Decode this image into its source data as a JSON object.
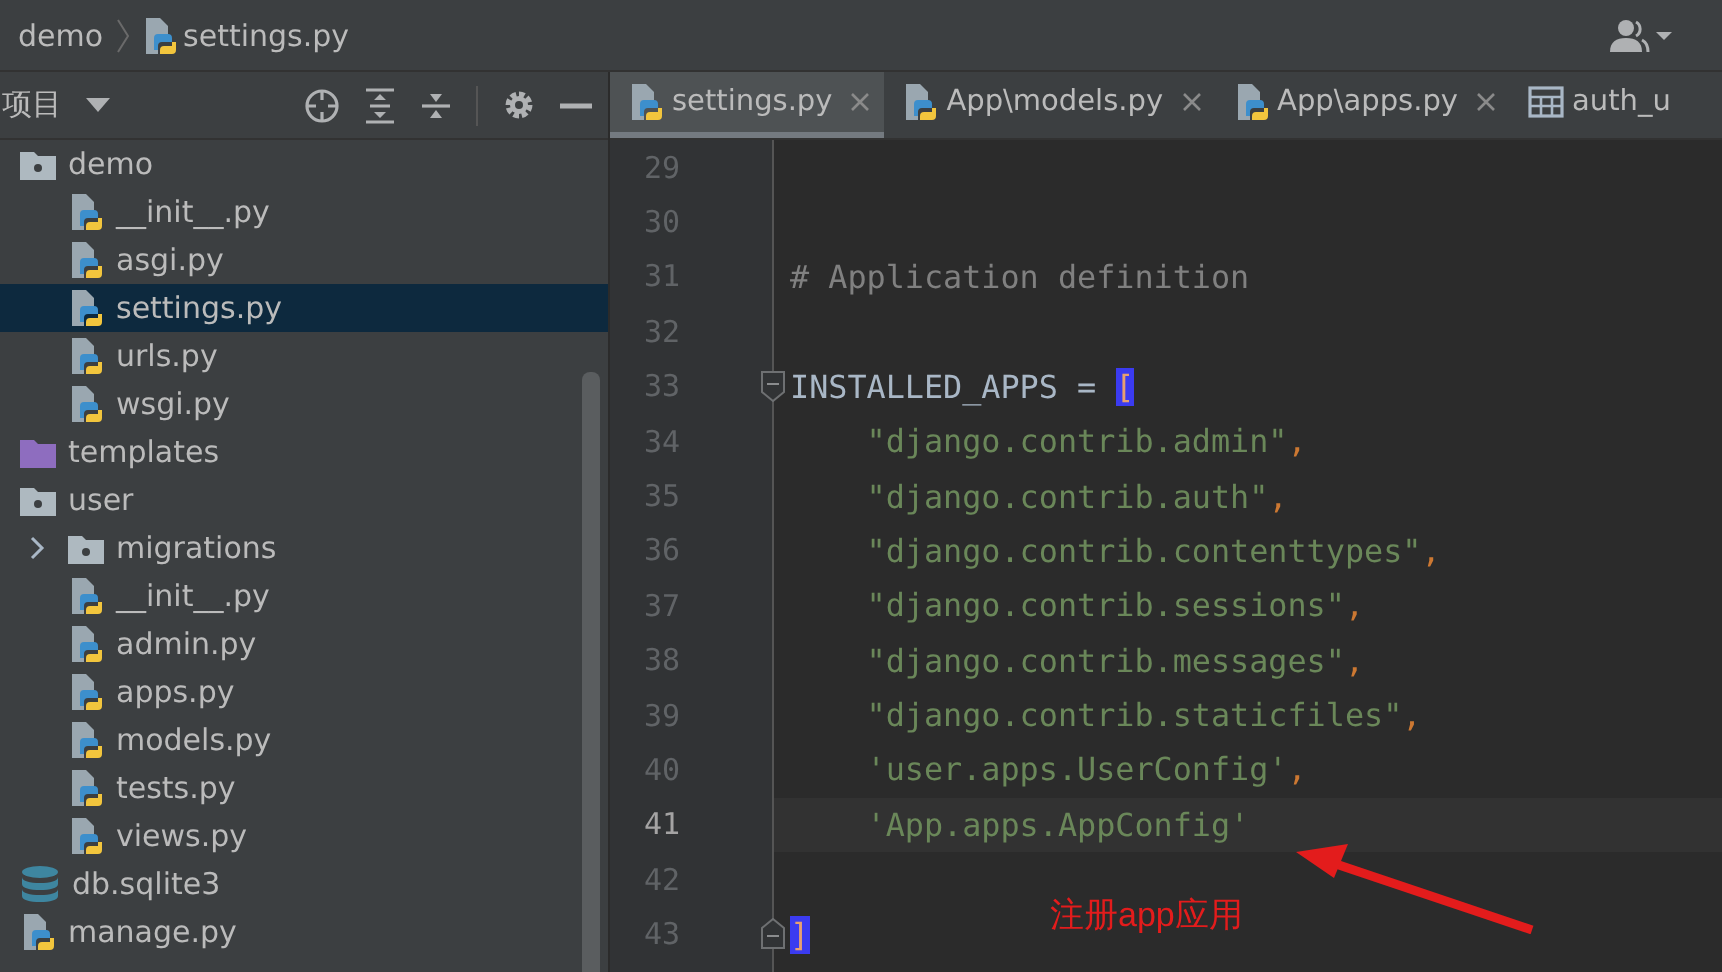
{
  "breadcrumb": [
    {
      "label": "demo",
      "kind": "folder"
    },
    {
      "label": "settings.py",
      "kind": "python"
    }
  ],
  "project_panel": {
    "title": "项目"
  },
  "tree": [
    {
      "label": "demo",
      "kind": "folder",
      "selected": false,
      "children": [
        {
          "label": "__init__.py",
          "kind": "python",
          "selected": false
        },
        {
          "label": "asgi.py",
          "kind": "python",
          "selected": false
        },
        {
          "label": "settings.py",
          "kind": "python",
          "selected": true
        },
        {
          "label": "urls.py",
          "kind": "python",
          "selected": false
        },
        {
          "label": "wsgi.py",
          "kind": "python",
          "selected": false
        }
      ]
    },
    {
      "label": "templates",
      "kind": "template-folder",
      "selected": false
    },
    {
      "label": "user",
      "kind": "folder",
      "selected": false,
      "children": [
        {
          "label": "migrations",
          "kind": "folder",
          "selected": false,
          "expanded": false
        },
        {
          "label": "__init__.py",
          "kind": "python",
          "selected": false
        },
        {
          "label": "admin.py",
          "kind": "python",
          "selected": false
        },
        {
          "label": "apps.py",
          "kind": "python",
          "selected": false
        },
        {
          "label": "models.py",
          "kind": "python",
          "selected": false
        },
        {
          "label": "tests.py",
          "kind": "python",
          "selected": false
        },
        {
          "label": "views.py",
          "kind": "python",
          "selected": false
        }
      ]
    },
    {
      "label": "db.sqlite3",
      "kind": "database",
      "selected": false
    },
    {
      "label": "manage.py",
      "kind": "python",
      "selected": false
    }
  ],
  "tabs": [
    {
      "label": "settings.py",
      "kind": "python",
      "selected": true,
      "closable": true
    },
    {
      "label": "App\\models.py",
      "kind": "python",
      "selected": false,
      "closable": true
    },
    {
      "label": "App\\apps.py",
      "kind": "python",
      "selected": false,
      "closable": true
    },
    {
      "label": "auth_u",
      "kind": "table",
      "selected": false,
      "closable": false
    }
  ],
  "code_lines": [
    {
      "number": "29",
      "current": false
    },
    {
      "number": "30",
      "current": false
    },
    {
      "number": "31",
      "current": false,
      "segments": [
        {
          "text": "# Application definition",
          "kind": "comment"
        }
      ]
    },
    {
      "number": "32",
      "current": false
    },
    {
      "number": "33",
      "current": false,
      "fold_start": true,
      "segments": [
        {
          "text": "INSTALLED_APPS = ",
          "kind": "plain"
        },
        {
          "text": "[",
          "kind": "bracket-match"
        }
      ]
    },
    {
      "number": "34",
      "current": false,
      "segments": [
        {
          "text": "    \"django.contrib.admin\"",
          "kind": "string"
        },
        {
          "text": ",",
          "kind": "punct"
        }
      ]
    },
    {
      "number": "35",
      "current": false,
      "segments": [
        {
          "text": "    \"django.contrib.auth\"",
          "kind": "string"
        },
        {
          "text": ",",
          "kind": "punct"
        }
      ]
    },
    {
      "number": "36",
      "current": false,
      "segments": [
        {
          "text": "    \"django.contrib.contenttypes\"",
          "kind": "string"
        },
        {
          "text": ",",
          "kind": "punct"
        }
      ]
    },
    {
      "number": "37",
      "current": false,
      "segments": [
        {
          "text": "    \"django.contrib.sessions\"",
          "kind": "string"
        },
        {
          "text": ",",
          "kind": "punct"
        }
      ]
    },
    {
      "number": "38",
      "current": false,
      "segments": [
        {
          "text": "    \"django.contrib.messages\"",
          "kind": "string"
        },
        {
          "text": ",",
          "kind": "punct"
        }
      ]
    },
    {
      "number": "39",
      "current": false,
      "segments": [
        {
          "text": "    \"django.contrib.staticfiles\"",
          "kind": "string"
        },
        {
          "text": ",",
          "kind": "punct"
        }
      ]
    },
    {
      "number": "40",
      "current": false,
      "segments": [
        {
          "text": "    'user.apps.UserConfig'",
          "kind": "string"
        },
        {
          "text": ",",
          "kind": "punct"
        }
      ]
    },
    {
      "number": "41",
      "current": true,
      "segments": [
        {
          "text": "    'App.apps.AppConfig'",
          "kind": "string"
        }
      ]
    },
    {
      "number": "42",
      "current": false
    },
    {
      "number": "43",
      "current": false,
      "fold_end": true,
      "segments": [
        {
          "text": "]",
          "kind": "bracket-match"
        }
      ]
    }
  ],
  "annotation": {
    "text": "注册app应用"
  }
}
